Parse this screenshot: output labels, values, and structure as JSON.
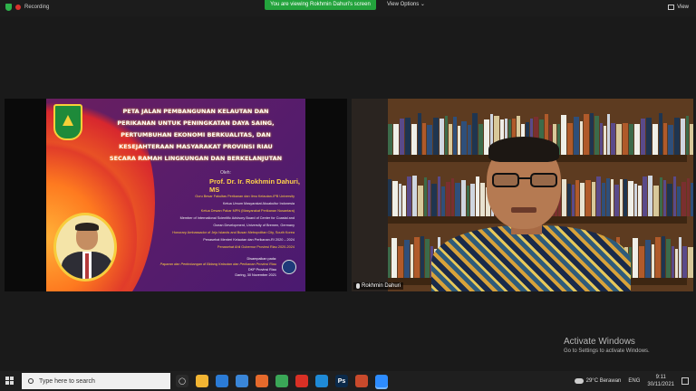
{
  "topbar": {
    "recording_label": "Recording",
    "viewing_banner": "You are viewing Rokhmin Dahuri's screen",
    "view_options_label": "View Options ⌄",
    "view_label": "View"
  },
  "slide": {
    "title_lines": [
      "PETA JALAN PEMBANGUNAN KELAUTAN DAN",
      "PERIKANAN UNTUK PENINGKATAN DAYA SAING,",
      "PERTUMBUHAN EKONOMI BERKUALITAS,  DAN",
      "KESEJAHTERAAN MASYARAKAT PROVINSI RIAU",
      "SECARA RAMAH LINGKUNGAN DAN BERKELANJUTAN"
    ],
    "oleh": "Oleh:",
    "presenter": "Prof. Dr. Ir. Rokhmin Dahuri, MS",
    "roles": [
      {
        "text": "Guru Besar Fakultas Perikanan dan Ilmu Kelautan-IPB University",
        "style": "gold"
      },
      {
        "text": "Ketua Umum Masyarakat Akuakultur Indonesia",
        "style": "white"
      },
      {
        "text": "Ketua Dewan Pakar MPN (Masyarakat Perikanan Nusantara)",
        "style": "gold"
      },
      {
        "text": "Member of International Scientific Advisory Board of Center for Coastal and",
        "style": "white"
      },
      {
        "text": "Ocean Development, University of Bremen, Germany",
        "style": "white"
      },
      {
        "text": "Honorary Ambassador of Jeju Islands and Busan Metropolitan City, South Korea",
        "style": "gold"
      },
      {
        "text": "Penasehat Menteri Kelautan dan Perikanan-RI 2020 – 2024",
        "style": "white"
      },
      {
        "text": "Penasehat Ahli Gubernur Provinsi Riau 2020-2024",
        "style": "gold"
      }
    ],
    "disampaikan": "Disampaikan pada:",
    "topic": "Paparan dan Pertimbangan di Bidang Kelautan dan Perikanan Provinsi Riau",
    "org": "DKP Provinsi Riau",
    "date": "Daring, 30 November 2021"
  },
  "video": {
    "participant_name": "Rokhmin Dahuri"
  },
  "watermark": {
    "line1": "Activate Windows",
    "line2": "Go to Settings to activate Windows."
  },
  "taskbar": {
    "search_placeholder": "Type here to search",
    "apps": [
      {
        "name": "task-view-icon",
        "color": "#2a2a2a",
        "glyph": "◯"
      },
      {
        "name": "file-explorer-icon",
        "color": "#f2b533",
        "glyph": ""
      },
      {
        "name": "mail-icon",
        "color": "#2b7bd6",
        "glyph": ""
      },
      {
        "name": "store-icon",
        "color": "#3a86d8",
        "glyph": ""
      },
      {
        "name": "firefox-icon",
        "color": "#e66a2c",
        "glyph": ""
      },
      {
        "name": "chrome-icon",
        "color": "#3aa757",
        "glyph": ""
      },
      {
        "name": "pdf-icon",
        "color": "#d93025",
        "glyph": ""
      },
      {
        "name": "edge-icon",
        "color": "#1f8ad6",
        "glyph": ""
      },
      {
        "name": "photoshop-icon",
        "color": "#0b2a4a",
        "glyph": "Ps"
      },
      {
        "name": "powerpoint-icon",
        "color": "#c94a2c",
        "glyph": ""
      },
      {
        "name": "zoom-icon",
        "color": "#2d8cff",
        "glyph": ""
      }
    ],
    "weather": "29°C  Berawan",
    "lang": "ENG",
    "time": "9:11",
    "date": "30/11/2021"
  },
  "colors": {
    "banner_green": "#23a33c",
    "slide_title": "#ffffff",
    "presenter_gold": "#ffd24a"
  }
}
